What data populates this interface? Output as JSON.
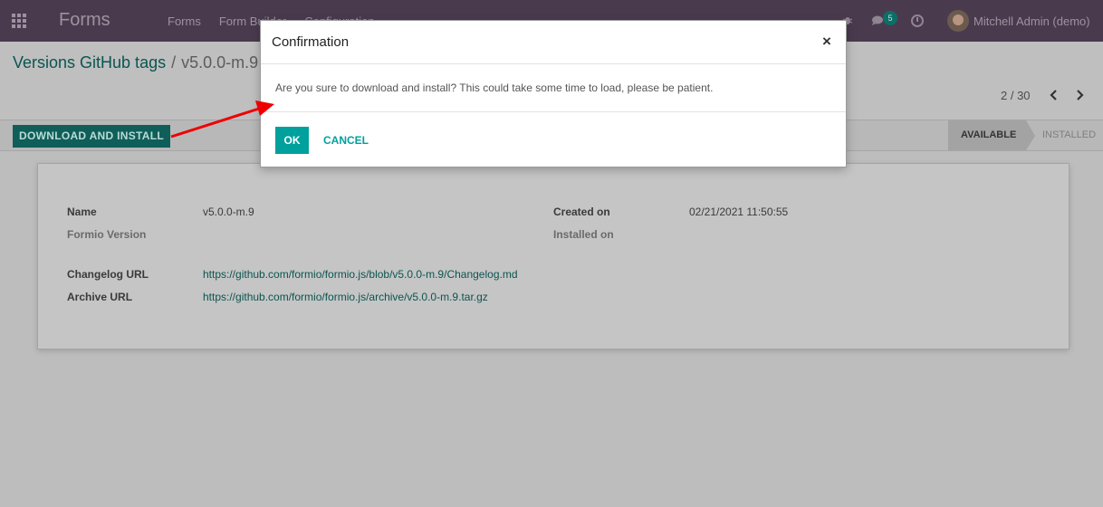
{
  "navbar": {
    "brand": "Forms",
    "menu": [
      "Forms",
      "Form Builder",
      "Configuration"
    ],
    "chat_count": "5",
    "user": "Mitchell Admin (demo)"
  },
  "breadcrumb": {
    "parent": "Versions GitHub tags",
    "separator": "/",
    "current": "v5.0.0-m.9"
  },
  "pager": {
    "value": "2 / 30"
  },
  "statusbar": {
    "install_button": "DOWNLOAD AND INSTALL",
    "stages": {
      "available": "AVAILABLE",
      "installed": "INSTALLED"
    }
  },
  "sheet": {
    "name_label": "Name",
    "name_value": "v5.0.0-m.9",
    "formio_version_label": "Formio Version",
    "created_on_label": "Created on",
    "created_on_value": "02/21/2021 11:50:55",
    "installed_on_label": "Installed on",
    "changelog_label": "Changelog URL",
    "changelog_value": "https://github.com/formio/formio.js/blob/v5.0.0-m.9/Changelog.md",
    "archive_label": "Archive URL",
    "archive_value": "https://github.com/formio/formio.js/archive/v5.0.0-m.9.tar.gz"
  },
  "modal": {
    "title": "Confirmation",
    "close": "×",
    "message": "Are you sure to download and install? This could take some time to load, please be patient.",
    "ok_label": "OK",
    "cancel_label": "CANCEL"
  },
  "colors": {
    "navbar": "#4a3a4e",
    "primary": "#00a09d",
    "link": "#0b5550",
    "annotation_arrow": "#ee0000"
  }
}
